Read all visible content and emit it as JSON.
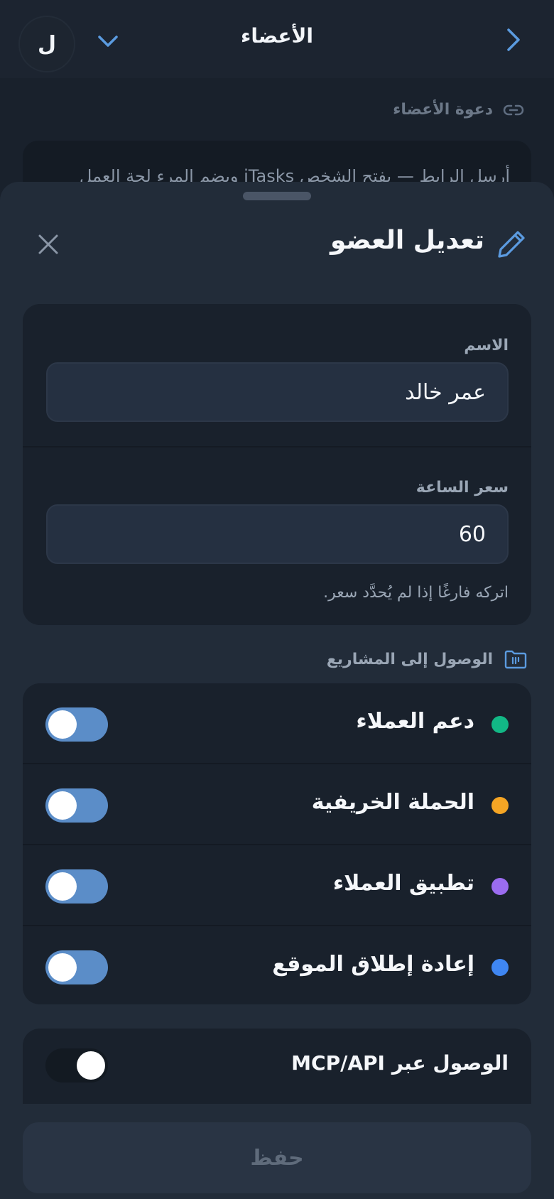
{
  "header": {
    "title": "الأعضاء",
    "avatar_initial": "ل"
  },
  "background": {
    "invite_label": "دعوة الأعضاء",
    "invite_text": "أرسل الرابط — يفتح الشخص iTasks ويضم المرء لحة العمل"
  },
  "sheet": {
    "title": "تعديل العضو",
    "name_label": "الاسم",
    "name_value": "عمر خالد",
    "rate_label": "سعر الساعة",
    "rate_value": "60",
    "rate_hint": "اتركه فارغًا إذا لم يُحدَّد سعر.",
    "projects_label": "الوصول إلى المشاريع",
    "projects": [
      {
        "name": "دعم العملاء",
        "color": "#12b886",
        "enabled": true
      },
      {
        "name": "الحملة الخريفية",
        "color": "#f5a524",
        "enabled": true
      },
      {
        "name": "تطبيق العملاء",
        "color": "#9b6cf0",
        "enabled": true
      },
      {
        "name": "إعادة إطلاق الموقع",
        "color": "#3f86f2",
        "enabled": true
      }
    ],
    "mcp_label": "الوصول عبر MCP/API",
    "mcp_enabled": false,
    "save_label": "حفظ"
  },
  "colors": {
    "accent": "#5b8dc8",
    "sheet_bg": "#222c39",
    "card_bg": "#19212c"
  }
}
